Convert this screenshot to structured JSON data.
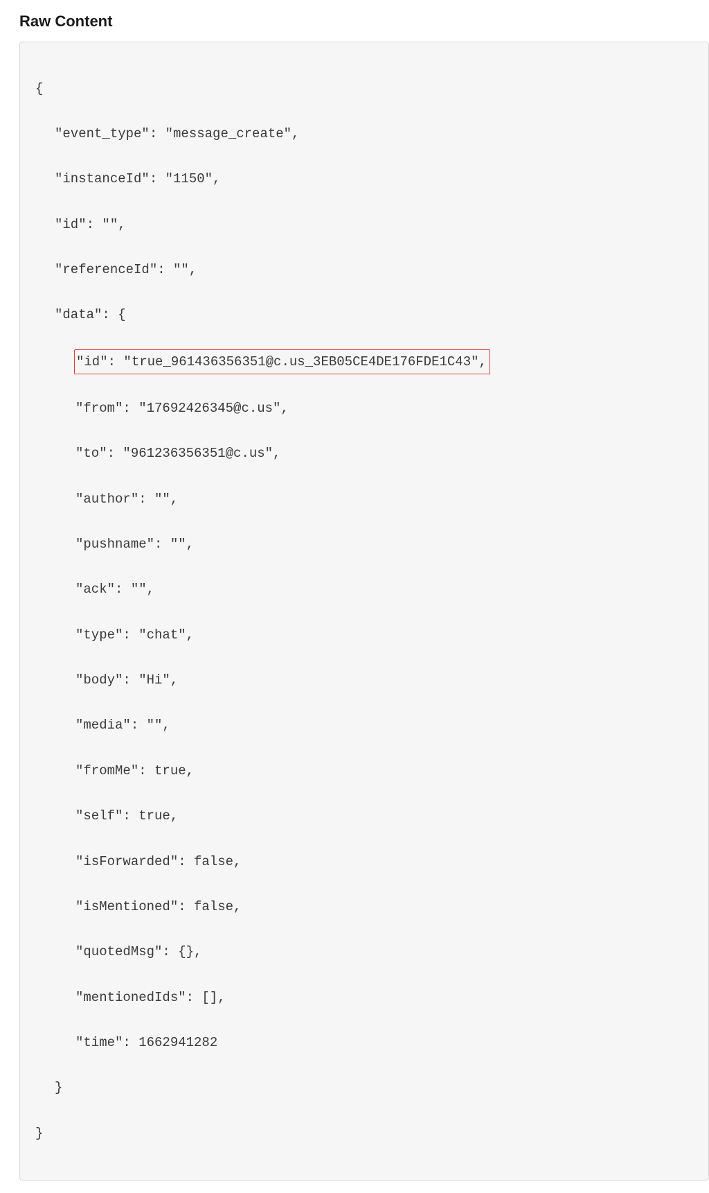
{
  "heading": "Raw Content",
  "code": {
    "open_brace": "{",
    "l1": "\"event_type\": \"message_create\",",
    "l2": "\"instanceId\": \"1150\",",
    "l3": "\"id\": \"\",",
    "l4": "\"referenceId\": \"\",",
    "l5": "\"data\": {",
    "l6_highlight": "\"id\": \"true_961436356351@c.us_3EB05CE4DE176FDE1C43\",",
    "l7": "\"from\": \"17692426345@c.us\",",
    "l8": "\"to\": \"961236356351@c.us\",",
    "l9": "\"author\": \"\",",
    "l10": "\"pushname\": \"\",",
    "l11": "\"ack\": \"\",",
    "l12": "\"type\": \"chat\",",
    "l13": "\"body\": \"Hi\",",
    "l14": "\"media\": \"\",",
    "l15": "\"fromMe\": true,",
    "l16": "\"self\": true,",
    "l17": "\"isForwarded\": false,",
    "l18": "\"isMentioned\": false,",
    "l19": "\"quotedMsg\": {},",
    "l20": "\"mentionedIds\": [],",
    "l21": "\"time\": 1662941282",
    "l22": "}",
    "close_brace": "}"
  }
}
